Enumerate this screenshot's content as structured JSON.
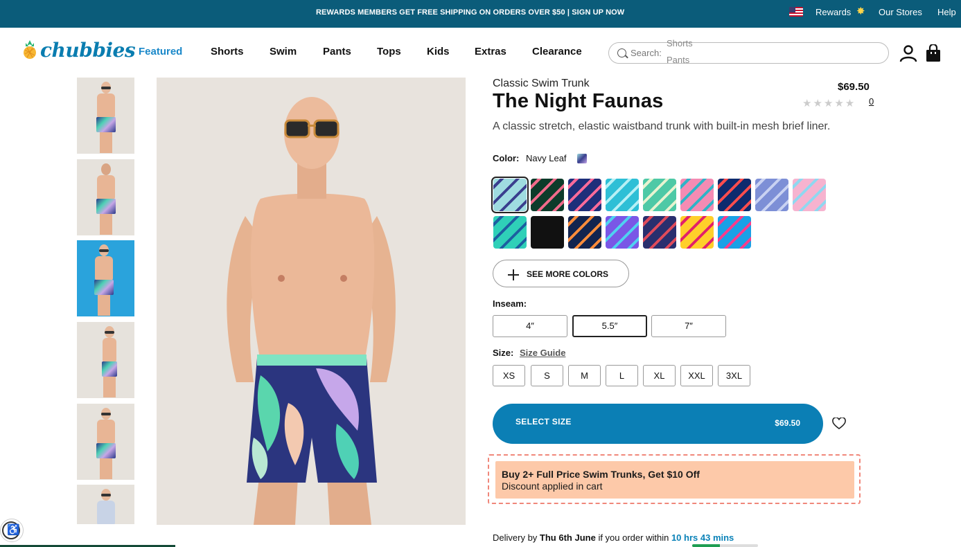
{
  "topbar": {
    "promo": "REWARDS MEMBERS GET FREE SHIPPING ON ORDERS OVER $50 | SIGN UP NOW",
    "flag_icon": "us-flag-icon",
    "rewards": "Rewards",
    "rewards_icon": "sparkle-star-icon",
    "stores": "Our Stores",
    "help": "Help",
    "bg_color": "#0b5c7a"
  },
  "brand": {
    "logo_text": "chubbies",
    "logo_icon": "pineapple-icon",
    "color": "#0a7db0"
  },
  "nav": {
    "items": [
      "Featured",
      "Shorts",
      "Swim",
      "Pants",
      "Tops",
      "Kids",
      "Extras",
      "Clearance"
    ],
    "active": "Featured",
    "active_color": "#1a88c9"
  },
  "search": {
    "label": "Search:",
    "rotating": [
      "Shorts",
      "Pants"
    ],
    "icon": "search-icon"
  },
  "header_icons": {
    "account": "account-icon",
    "bag": "shopping-bag-icon"
  },
  "product": {
    "subtitle": "Classic Swim Trunk",
    "name": "The Night Faunas",
    "price": "$69.50",
    "rating_stars": "★★★★★",
    "review_count": "0",
    "description": "A classic stretch, elastic waistband trunk with built-in mesh brief liner."
  },
  "color": {
    "label": "Color:",
    "selected": "Navy Leaf",
    "swatch_colors": [
      [
        "#9fdce0",
        "#3a3f8e"
      ],
      [
        "#0d3b2a",
        "#f06a8a"
      ],
      [
        "#1e2f7a",
        "#ff6b9a"
      ],
      [
        "#2ebfd6",
        "#b7f0f5"
      ],
      [
        "#4ec9a6",
        "#e8f3d0"
      ],
      [
        "#f48bb3",
        "#2fb3c7"
      ],
      [
        "#0e2b6e",
        "#ff4d4d"
      ],
      [
        "#7d8fd6",
        "#c9d2f2"
      ],
      [
        "#f6b3cf",
        "#8fd8f0"
      ],
      [
        "#2fd0b8",
        "#1c5fa0"
      ],
      [
        "#111111",
        "#222222"
      ],
      [
        "#13244f",
        "#ff8c3a"
      ],
      [
        "#7a57e6",
        "#4fd2f0"
      ],
      [
        "#2a2f6e",
        "#e04b5a"
      ],
      [
        "#ffcf2a",
        "#e2206a"
      ],
      [
        "#1aa0e6",
        "#ff3b8a"
      ]
    ],
    "see_more": "SEE MORE COLORS"
  },
  "inseam": {
    "label": "Inseam:",
    "options": [
      "4″",
      "5.5″",
      "7″"
    ],
    "selected": "5.5″"
  },
  "size": {
    "label": "Size:",
    "guide": "Size Guide",
    "options": [
      "XS",
      "S",
      "M",
      "L",
      "XL",
      "XXL",
      "3XL"
    ]
  },
  "cta": {
    "label": "SELECT SIZE",
    "price": "$69.50",
    "color": "#0b7fb5",
    "wishlist_icon": "heart-icon"
  },
  "promo": {
    "title": "Buy 2+ Full Price Swim Trunks, Get $10 Off",
    "subtitle": "Discount applied in cart",
    "bg_color": "#fdc9a9",
    "border_color": "#f0877a"
  },
  "delivery": {
    "prefix": "Delivery by",
    "date": "Thu 6th June",
    "middle": "if you order within",
    "countdown": "10 hrs 43 mins",
    "progress": 0.42,
    "progress_color": "#1f9e52"
  },
  "accessibility_icon": "accessibility-icon"
}
